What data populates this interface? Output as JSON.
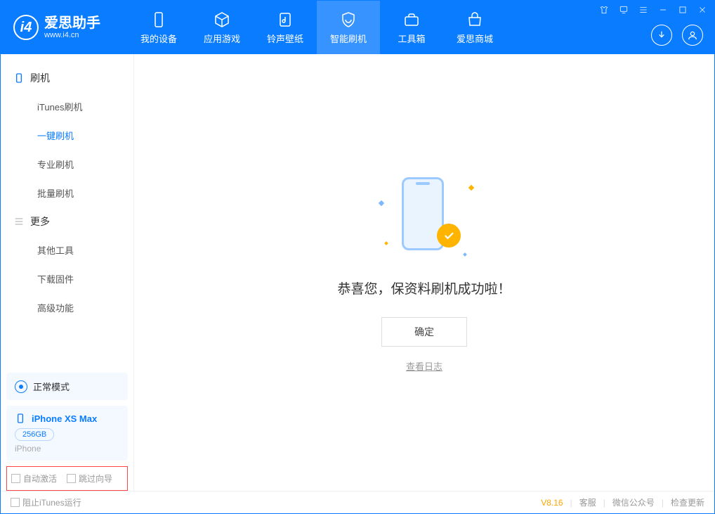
{
  "logo": {
    "title": "爱思助手",
    "sub": "www.i4.cn"
  },
  "nav": {
    "items": [
      {
        "label": "我的设备"
      },
      {
        "label": "应用游戏"
      },
      {
        "label": "铃声壁纸"
      },
      {
        "label": "智能刷机"
      },
      {
        "label": "工具箱"
      },
      {
        "label": "爱思商城"
      }
    ]
  },
  "sidebar": {
    "section1_title": "刷机",
    "section1_items": [
      "iTunes刷机",
      "一键刷机",
      "专业刷机",
      "批量刷机"
    ],
    "section2_title": "更多",
    "section2_items": [
      "其他工具",
      "下载固件",
      "高级功能"
    ]
  },
  "mode": {
    "label": "正常模式"
  },
  "device": {
    "name": "iPhone XS Max",
    "capacity": "256GB",
    "type": "iPhone"
  },
  "options": {
    "auto_activate": "自动激活",
    "skip_guide": "跳过向导"
  },
  "main": {
    "success_text": "恭喜您，保资料刷机成功啦！",
    "ok_label": "确定",
    "log_label": "查看日志"
  },
  "footer": {
    "block_itunes": "阻止iTunes运行",
    "version": "V8.16",
    "links": [
      "客服",
      "微信公众号",
      "检查更新"
    ]
  }
}
